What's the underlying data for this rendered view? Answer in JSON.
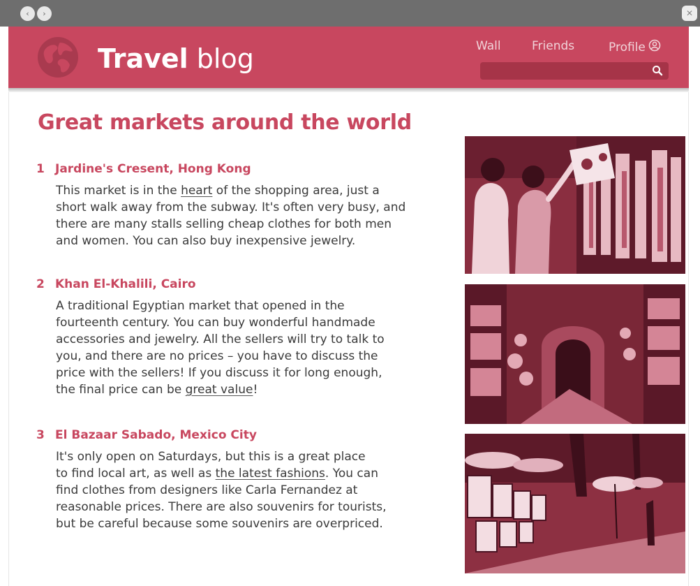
{
  "browser": {
    "back_label": "‹",
    "forward_label": "›",
    "close_label": "✕"
  },
  "header": {
    "brand_bold": "Travel",
    "brand_light": "blog",
    "nav": {
      "wall": "Wall",
      "friends": "Friends",
      "profile": "Profile"
    },
    "search": {
      "placeholder": "",
      "value": ""
    }
  },
  "article": {
    "title": "Great markets around the world",
    "markets": [
      {
        "number": "1",
        "name": "Jardine's Cresent, Hong Kong",
        "lines": [
          [
            "This market is in the ",
            "heart",
            " of the shopping area, just a"
          ],
          [
            "short walk away from the subway. It's often very busy, and"
          ],
          [
            "there are many stalls selling cheap clothes for both men"
          ],
          [
            "and women. You can also buy inexpensive jewelry."
          ]
        ]
      },
      {
        "number": "2",
        "name": "Khan El-Khalili, Cairo",
        "lines": [
          [
            "A traditional Egyptian market that opened in the"
          ],
          [
            "fourteenth century. You can buy wonderful handmade"
          ],
          [
            "accessories and jewelry. All the sellers will try to talk to"
          ],
          [
            "you, and there are no prices – you have to discuss the"
          ],
          [
            "price with the sellers! If you discuss it for long enough,"
          ],
          [
            "the final price can be ",
            "great value",
            "!"
          ]
        ]
      },
      {
        "number": "3",
        "name": "El Bazaar Sabado, Mexico City",
        "lines": [
          [
            "It's only open on Saturdays, but this is a great place"
          ],
          [
            "to find local art, as well as ",
            "the latest fashions",
            ". You can"
          ],
          [
            "find clothes from designers like Carla Fernandez at"
          ],
          [
            "reasonable prices. There are also souvenirs for tourists,"
          ],
          [
            "but be careful because some souvenirs are overpriced."
          ]
        ]
      }
    ]
  },
  "colors": {
    "brand": "#c8475f",
    "brand_dark": "#a63448",
    "chrome": "#6e6e6e",
    "text": "#3a3a3a"
  }
}
